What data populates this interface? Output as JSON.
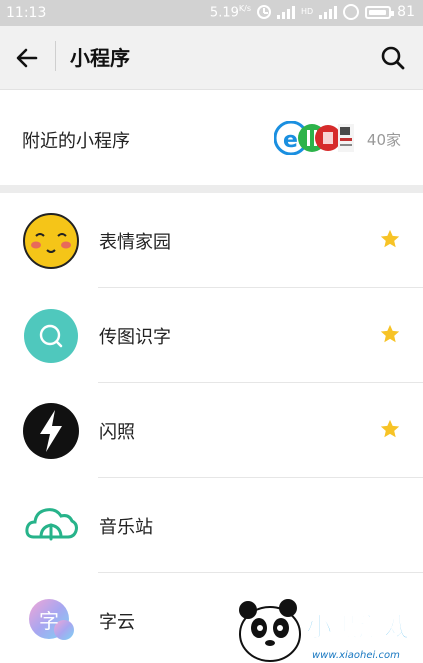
{
  "status_bar": {
    "time": "11:13",
    "speed": "5.19",
    "speed_unit": "K/s",
    "hd": "HD",
    "battery": "81"
  },
  "header": {
    "title": "小程序",
    "back_icon": "back-arrow-icon",
    "search_icon": "search-icon"
  },
  "nearby": {
    "title": "附近的小程序",
    "count": "40家"
  },
  "apps": [
    {
      "name": "表情家园",
      "icon": "smiley-face-icon",
      "starred": true
    },
    {
      "name": "传图识字",
      "icon": "magnifier-circle-icon",
      "starred": true
    },
    {
      "name": "闪照",
      "icon": "lightning-icon",
      "starred": true
    },
    {
      "name": "音乐站",
      "icon": "cloud-music-icon",
      "starred": false
    },
    {
      "name": "字云",
      "icon": "word-cloud-icon",
      "starred": false
    }
  ],
  "watermark": {
    "text": "小黑游戏",
    "url": "www.xiaohei.com"
  },
  "colors": {
    "status_bar": "#d2d2d2",
    "header_bg": "#f1f1f1",
    "star": "#f7c326",
    "smiley": "#f5c518",
    "teal": "#4fc8bd",
    "music_green": "#27b38a"
  }
}
